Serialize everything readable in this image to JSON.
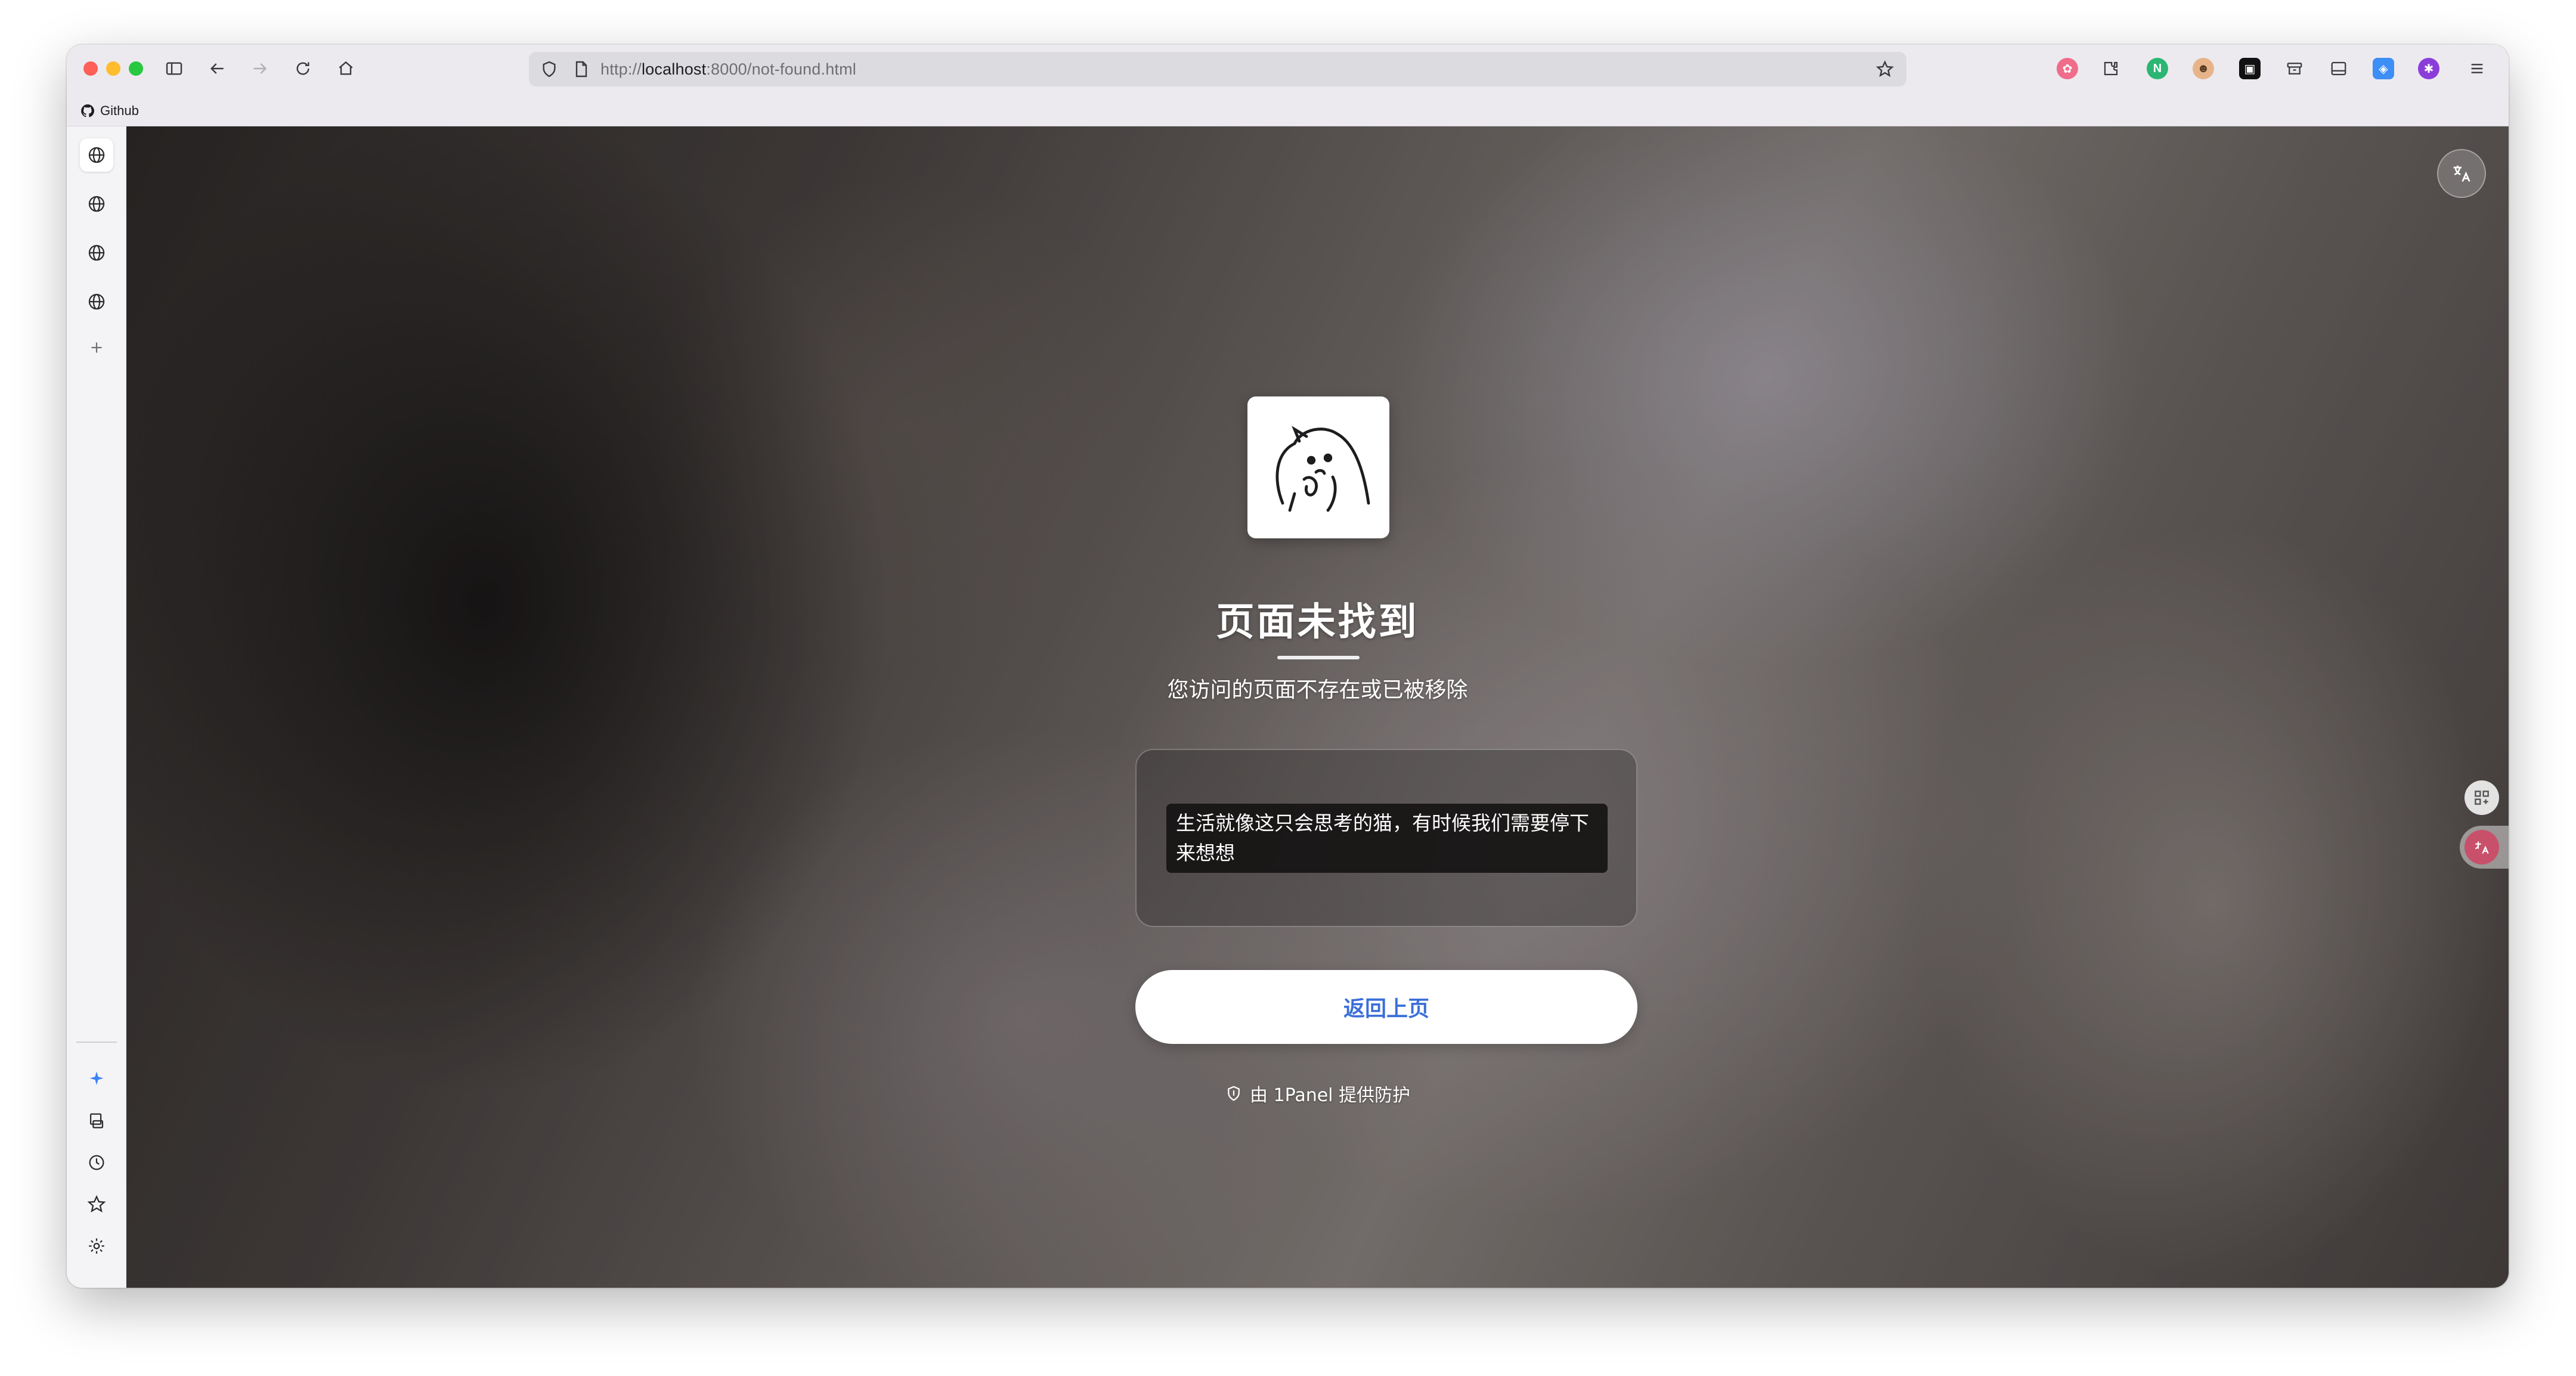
{
  "browser": {
    "url_prefix": "http://",
    "url_host": "localhost",
    "url_rest": ":8000/not-found.html",
    "bookmark_label": "Github"
  },
  "page": {
    "title": "页面未找到",
    "subtitle": "您访问的页面不存在或已被移除",
    "quote": "生活就像这只会思考的猫，有时候我们需要停下来想想",
    "back_button": "返回上页",
    "footer": "由 1Panel 提供防护"
  },
  "colors": {
    "button_text": "#3b6fd8",
    "accent_sparkle": "#3b82f6"
  },
  "icons": {
    "sidebar_top": [
      "globe-icon",
      "globe-icon",
      "globe-icon",
      "globe-icon",
      "plus-icon"
    ],
    "sidebar_bottom": [
      "sparkle-icon",
      "library-icon",
      "history-icon",
      "bookmark-star-icon",
      "settings-icon"
    ]
  }
}
